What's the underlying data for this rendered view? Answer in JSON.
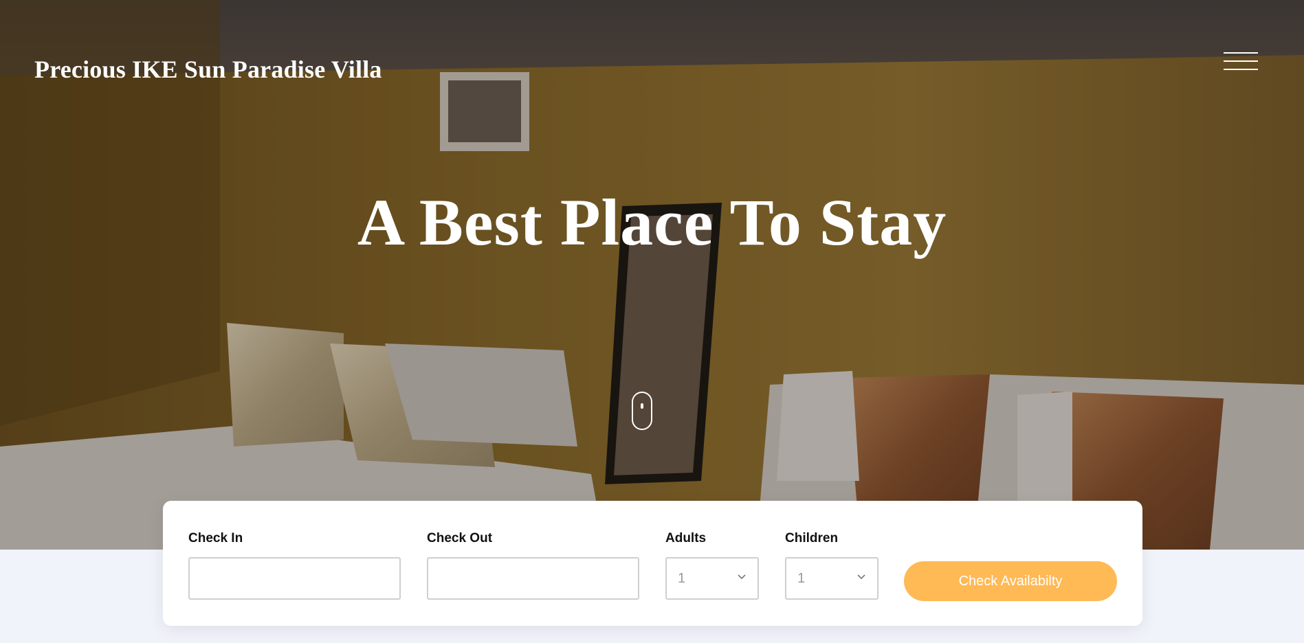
{
  "header": {
    "brand": "Precious IKE Sun Paradise Villa",
    "menu_icon": "hamburger-menu-icon"
  },
  "hero": {
    "headline": "A Best Place To Stay",
    "scroll_icon": "mouse-scroll-icon"
  },
  "booking": {
    "check_in": {
      "label": "Check In",
      "value": "",
      "placeholder": ""
    },
    "check_out": {
      "label": "Check Out",
      "value": "",
      "placeholder": ""
    },
    "adults": {
      "label": "Adults",
      "value": "1"
    },
    "children": {
      "label": "Children",
      "value": "1"
    },
    "submit_label": "Check Availabilty"
  },
  "colors": {
    "accent": "#ffb955",
    "page_background": "#f0f3fa",
    "panel_background": "#ffffff"
  }
}
